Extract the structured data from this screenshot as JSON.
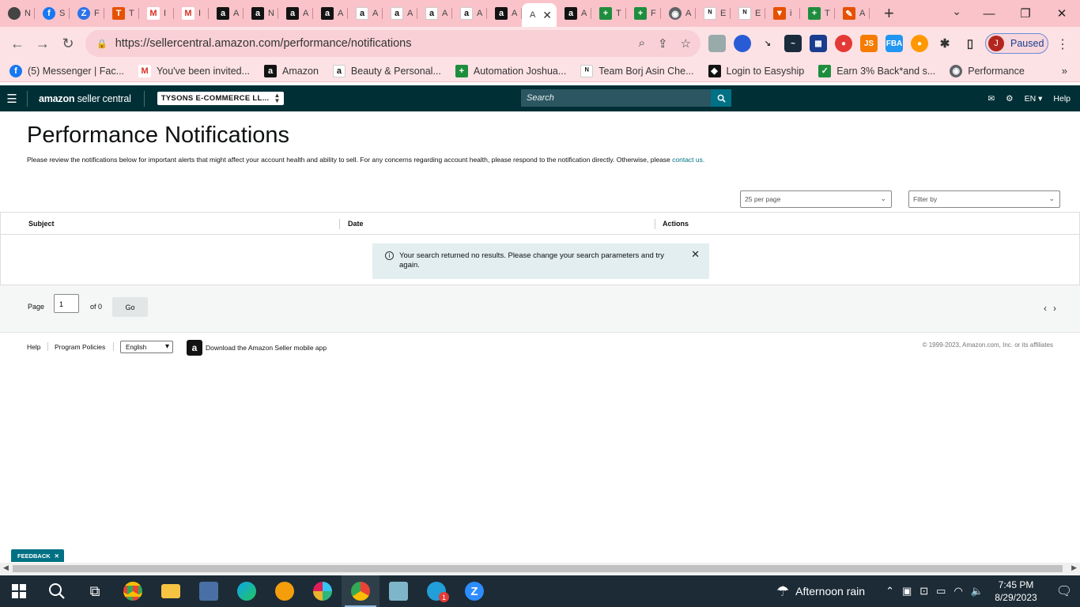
{
  "browser": {
    "active_tab_title": "A",
    "tabs": [
      {
        "icon": "chrome-icon",
        "title": "N"
      },
      {
        "icon": "facebook-icon",
        "title": "S"
      },
      {
        "icon": "zoom-icon",
        "title": "F"
      },
      {
        "icon": "tool-icon",
        "title": "T"
      },
      {
        "icon": "gmail-icon",
        "title": "I"
      },
      {
        "icon": "gmail-icon",
        "title": "I"
      },
      {
        "icon": "amazon-icon",
        "title": "A"
      },
      {
        "icon": "amazon-icon",
        "title": "N"
      },
      {
        "icon": "amazon-icon",
        "title": "A"
      },
      {
        "icon": "amazon-icon",
        "title": "A"
      },
      {
        "icon": "amazon-smile-icon",
        "title": "A"
      },
      {
        "icon": "amazon-smile-icon",
        "title": "A"
      },
      {
        "icon": "amazon-smile-icon",
        "title": "A"
      },
      {
        "icon": "amazon-smile-icon",
        "title": "A"
      },
      {
        "icon": "amazon-icon",
        "title": "A"
      }
    ],
    "tabs_after": [
      {
        "icon": "amazon-icon",
        "title": "A"
      },
      {
        "icon": "sheets-icon",
        "title": "T"
      },
      {
        "icon": "sheets-icon",
        "title": "F"
      },
      {
        "icon": "globe-icon",
        "title": "A"
      },
      {
        "icon": "chart-icon",
        "title": "E"
      },
      {
        "icon": "chart-icon",
        "title": "E"
      },
      {
        "icon": "triangle-icon",
        "title": "i"
      },
      {
        "icon": "sheets-icon",
        "title": "T"
      },
      {
        "icon": "pencil-icon",
        "title": "A"
      }
    ],
    "url": "https://sellercentral.amazon.com/performance/notifications",
    "profile_initial": "J",
    "profile_label": "Paused",
    "bookmarks": [
      {
        "icon": "facebook-icon",
        "label": "(5) Messenger | Fac..."
      },
      {
        "icon": "gmail-icon",
        "label": "You've been invited..."
      },
      {
        "icon": "amazon-icon",
        "label": "Amazon"
      },
      {
        "icon": "amazon-smile-icon",
        "label": "Beauty & Personal..."
      },
      {
        "icon": "sheets-icon",
        "label": "Automation Joshua..."
      },
      {
        "icon": "chart-icon",
        "label": "Team Borj Asin Che..."
      },
      {
        "icon": "easyship-icon",
        "label": "Login to Easyship"
      },
      {
        "icon": "cashback-icon",
        "label": "Earn 3% Back*and s..."
      },
      {
        "icon": "globe-icon",
        "label": "Performance"
      }
    ]
  },
  "header": {
    "brand_bold": "amazon",
    "brand_rest": " seller central",
    "account": "TYSONS E-COMMERCE LL...",
    "search_placeholder": "Search",
    "language": "EN",
    "help": "Help"
  },
  "main": {
    "title": "Performance Notifications",
    "intro": "Please review the notifications below for important alerts that might affect your account health and ability to sell. For any concerns regarding account health, please respond to the notification directly. Otherwise, please ",
    "contact_link": "contact us.",
    "per_page": "25 per page",
    "filter": "Filter by",
    "columns": [
      "Subject",
      "Date",
      "Actions"
    ],
    "alert": "Your search returned no results. Please change your search parameters and try again."
  },
  "pagination": {
    "page_label": "Page",
    "page_value": "1",
    "of_label": "of 0",
    "go": "Go"
  },
  "footer": {
    "help": "Help",
    "policies": "Program Policies",
    "language": "English",
    "app_text": "Download the Amazon Seller mobile app",
    "copyright": "© 1999-2023, Amazon.com, Inc. or its affiliates"
  },
  "feedback": "FEEDBACK",
  "taskbar": {
    "weather": "Afternoon rain",
    "time": "7:45 PM",
    "date": "8/29/2023",
    "badge": "1"
  },
  "colors": {
    "tab_bar": "#f9c3c9",
    "amazon_header": "#002f36",
    "accent_teal": "#007185"
  }
}
